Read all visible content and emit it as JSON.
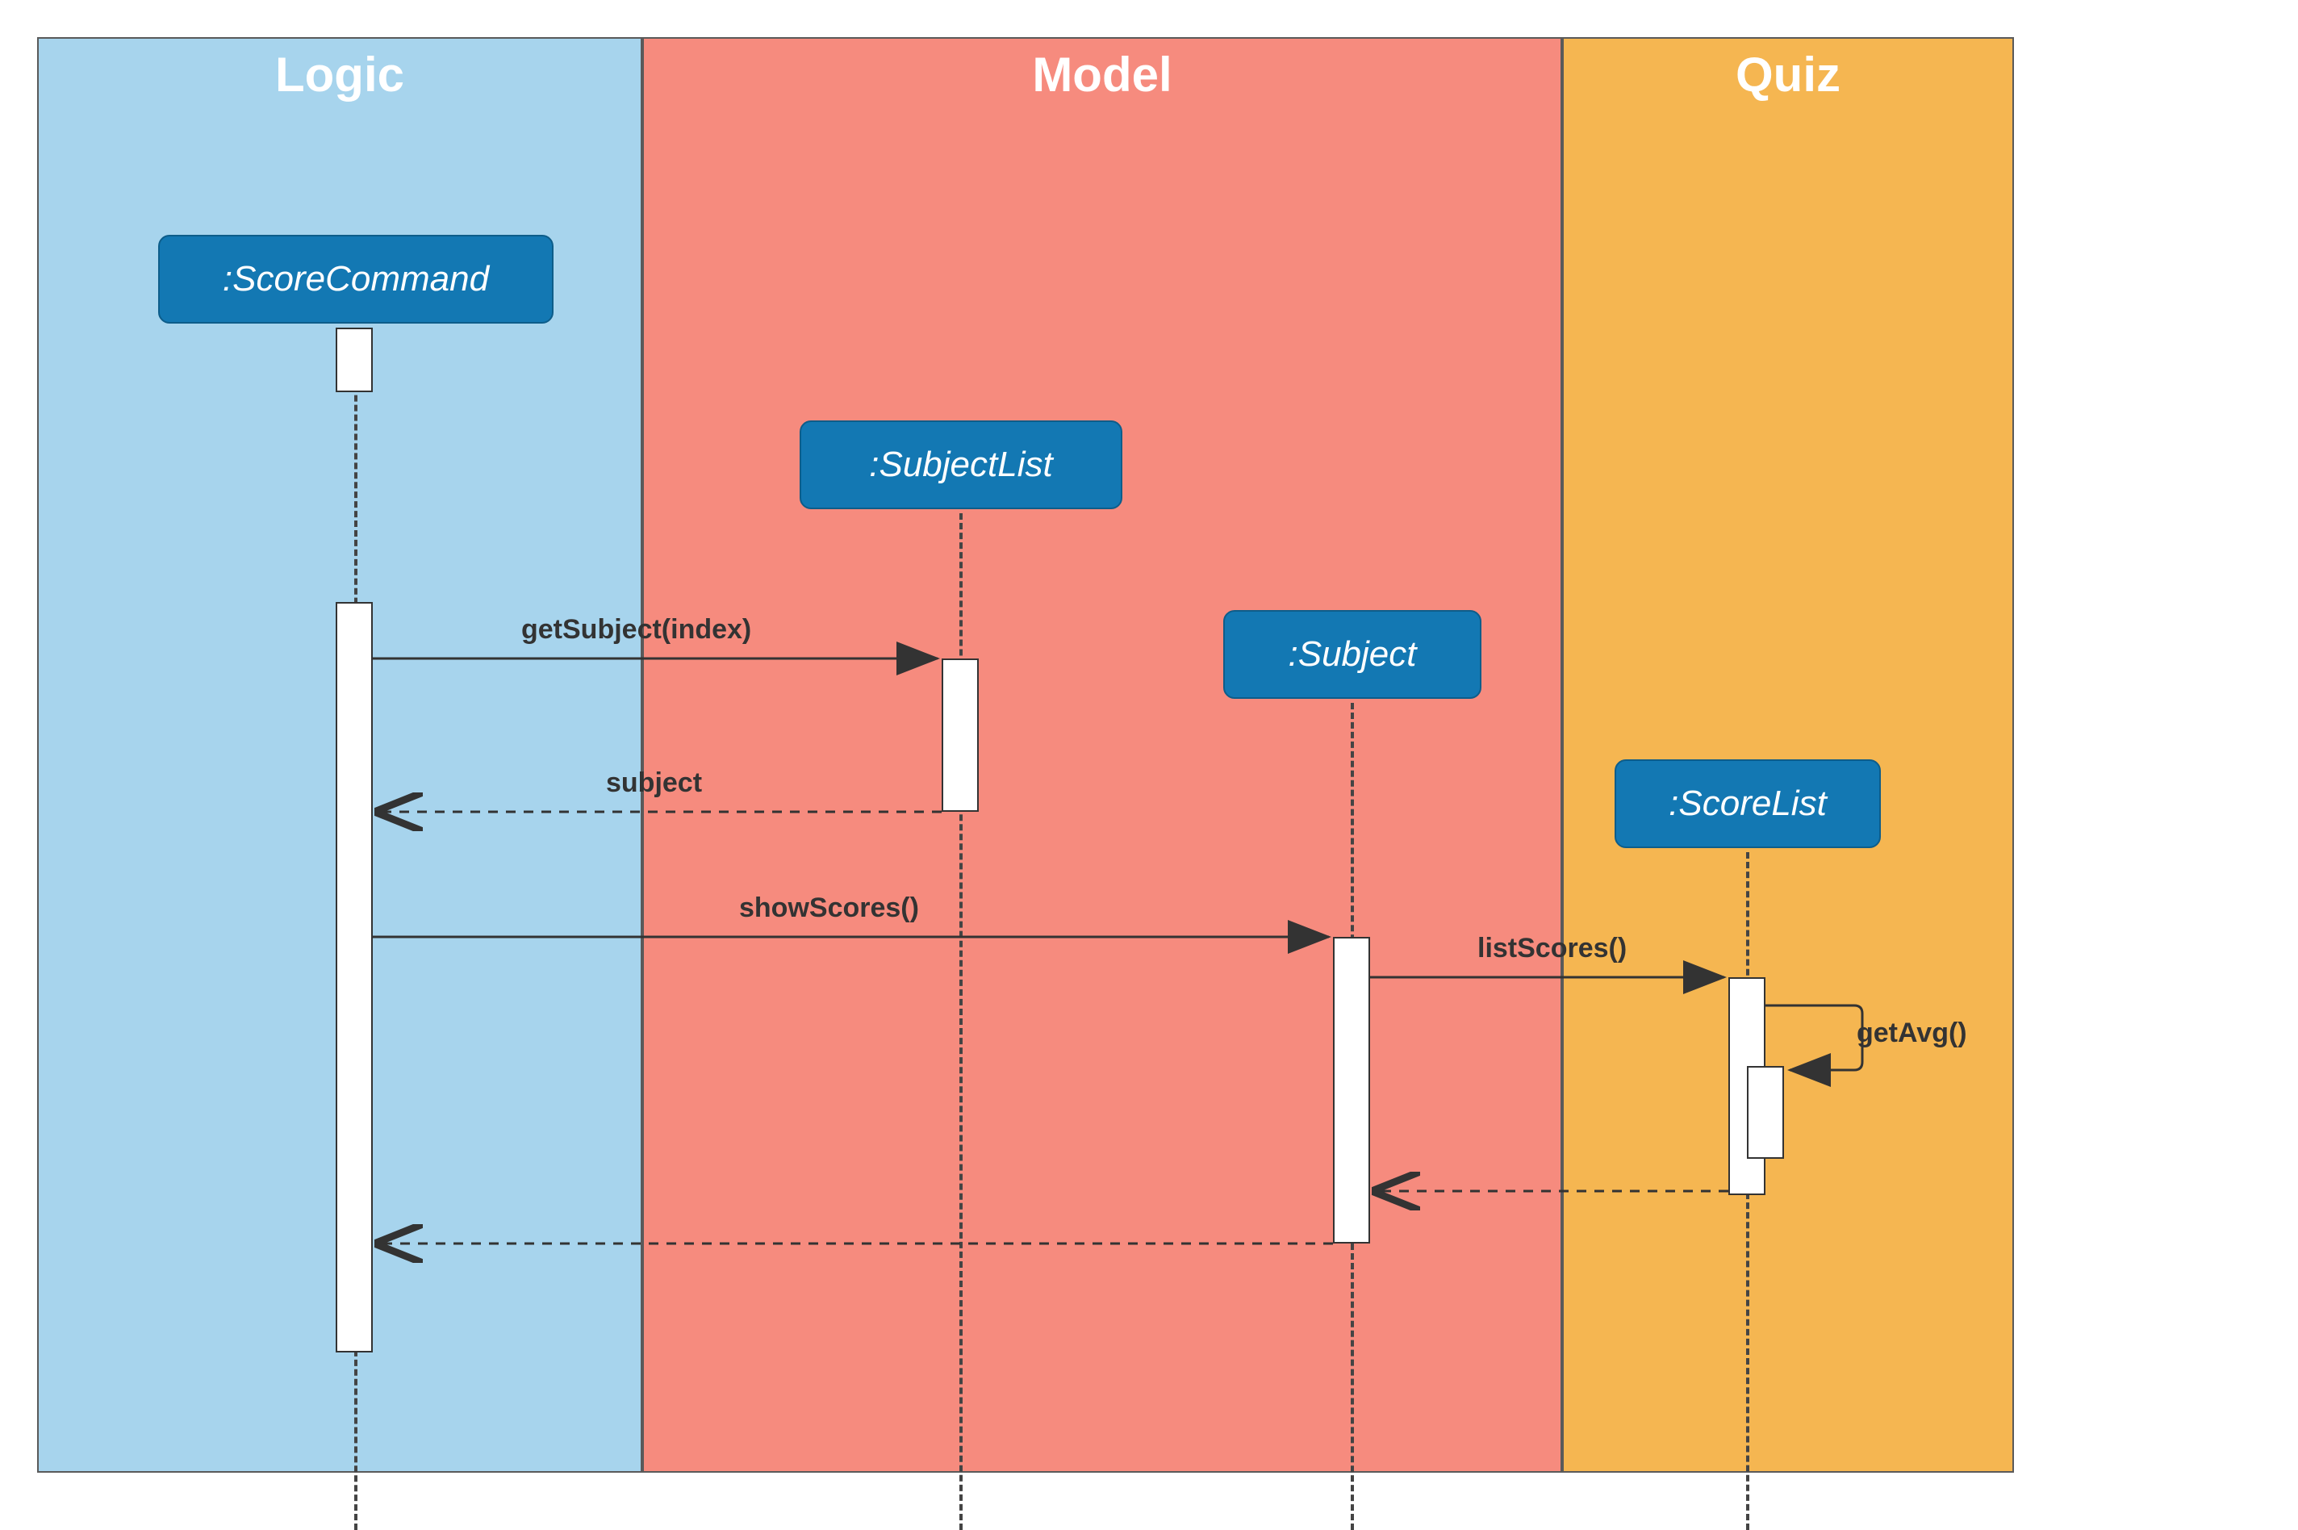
{
  "lanes": {
    "logic": "Logic",
    "model": "Model",
    "quiz": "Quiz"
  },
  "participants": {
    "scoreCommand": ":ScoreCommand",
    "subjectList": ":SubjectList",
    "subject": ":Subject",
    "scoreList": ":ScoreList"
  },
  "messages": {
    "getSubject": "getSubject(index)",
    "subject": "subject",
    "showScores": "showScores()",
    "listScores": "listScores()",
    "getAvg": "getAvg()"
  }
}
